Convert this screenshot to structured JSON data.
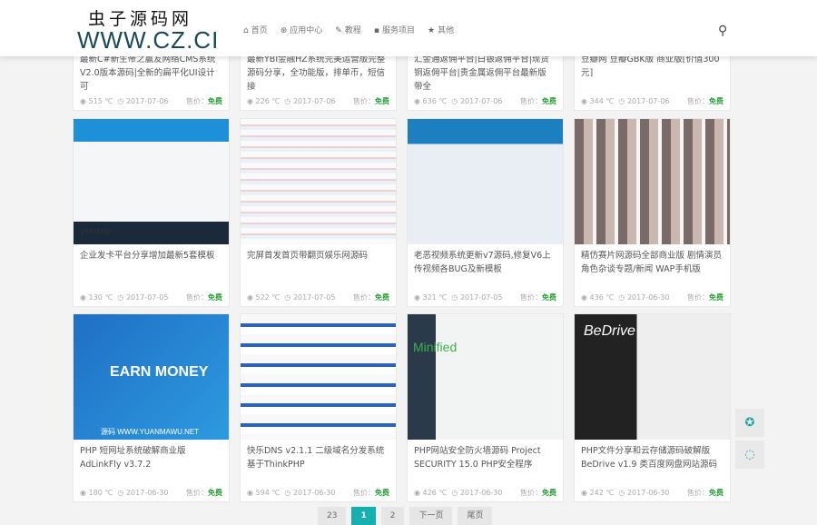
{
  "logo": {
    "cn": "虫子源码网",
    "url": "WWW.CZ.CI"
  },
  "nav": [
    {
      "icon": "home-icon",
      "glyph": "⌂",
      "label": "首页"
    },
    {
      "icon": "apps-icon",
      "glyph": "⊛",
      "label": "应用中心"
    },
    {
      "icon": "wrench-icon",
      "glyph": "✎",
      "label": "教程"
    },
    {
      "icon": "briefcase-icon",
      "glyph": "▪",
      "label": "服务项目"
    },
    {
      "icon": "star-icon",
      "glyph": "★",
      "label": "其他"
    }
  ],
  "price_label": "售价：",
  "price": "免费",
  "cards": [
    {
      "title": "最新C#新生帝之赢友网络CMS系统V2.0版本源码|全新的扁平化UI设计 可",
      "views": "515 ℃",
      "date": "2017-07-06"
    },
    {
      "title": "最新YBI金融HZ系统完美运营版完整源码分享，全功能版，排单币，短信接",
      "views": "226 ℃",
      "date": "2017-07-06"
    },
    {
      "title": "汇金通返佣平台|白银返佣平台|现货铜返佣平台|贵金属返佣平台最新版 带全",
      "views": "636 ℃",
      "date": "2017-07-06"
    },
    {
      "title": "豆瓣网 豆瓣GBK版 商业版[价值300元]",
      "views": "344 ℃",
      "date": "2017-07-06"
    },
    {
      "title": "企业发卡平台分享增加最新5套模板",
      "views": "130 ℃",
      "date": "2017-07-05",
      "thumb_text": "yektipay"
    },
    {
      "title": "完屏首发首页带翻页娱乐网源码",
      "views": "522 ℃",
      "date": "2017-07-05",
      "thumb_text": ""
    },
    {
      "title": "老恶视频系统更新v7源码,修复V6上传视频各BUG及新模板",
      "views": "321 ℃",
      "date": "2017-07-05",
      "thumb_text": ""
    },
    {
      "title": "精仿赛片网源码全部商业版 剧情演员角色杂谈专题/新闻 WAP手机版",
      "views": "436 ℃",
      "date": "2017-06-30",
      "thumb_text": ""
    },
    {
      "title": "PHP 短网址系统破解商业版 AdLinkFly v3.7.2",
      "views": "180 ℃",
      "date": "2017-06-30",
      "thumb_text": "EARN MONEY",
      "thumb_sub": "源码 WWW.YUANMAWU.NET"
    },
    {
      "title": "快乐DNS v2.1.1 二级域名分发系统 基于ThinkPHP",
      "views": "594 ℃",
      "date": "2017-06-30",
      "thumb_text": ""
    },
    {
      "title": "PHP网站安全防火墙源码 Project SECURITY 15.0 PHP安全程序",
      "views": "426 ℃",
      "date": "2017-06-30",
      "thumb_text": "Minified"
    },
    {
      "title": "PHP文件分享和云存储源码破解版 BeDrive v1.9 类百度网盘网站源码",
      "views": "242 ℃",
      "date": "2017-06-30",
      "thumb_text": "BeDrive"
    }
  ],
  "pager": {
    "total": "23",
    "current": "1",
    "next_num": "2",
    "next": "下一页",
    "last": "尾页"
  },
  "side": [
    {
      "icon": "qq-icon",
      "glyph": "✪"
    },
    {
      "icon": "chat-icon",
      "glyph": "◌"
    }
  ]
}
